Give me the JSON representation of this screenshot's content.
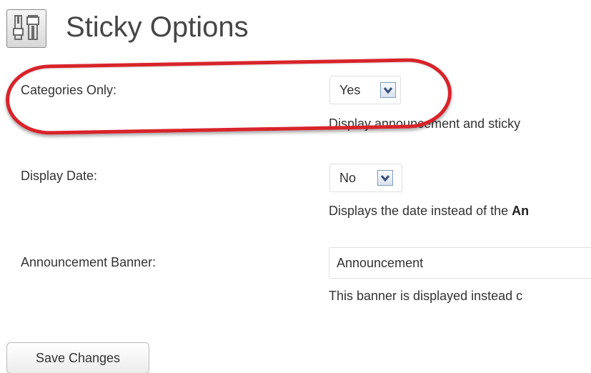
{
  "header": {
    "title": "Sticky Options",
    "icon": "settings-sliders-icon"
  },
  "options": {
    "categories_only": {
      "label": "Categories Only:",
      "value": "Yes",
      "description": "Display announcement and sticky"
    },
    "display_date": {
      "label": "Display Date:",
      "value": "No",
      "description_prefix": "Displays the date instead of the ",
      "description_bold": "An"
    },
    "announcement_banner": {
      "label": "Announcement Banner:",
      "value": "Announcement",
      "description": "This banner is displayed instead c"
    }
  },
  "actions": {
    "save_label": "Save Changes"
  },
  "annotation": {
    "color": "#d8232a",
    "shape": "oval highlight"
  }
}
